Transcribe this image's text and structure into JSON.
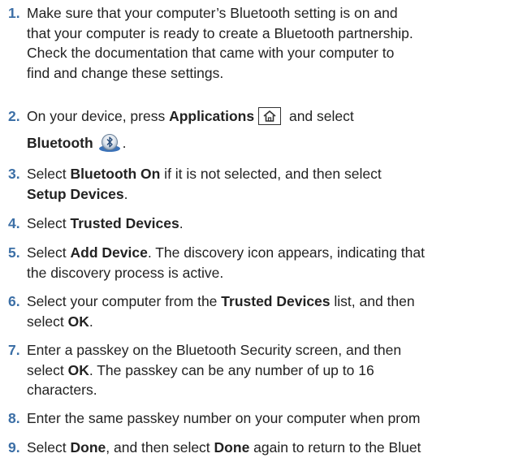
{
  "steps": [
    {
      "number": "1.",
      "lines": [
        "Make sure that your computer’s Bluetooth setting is on and",
        "that your computer is ready to create a Bluetooth partnership.",
        "Check the documentation that came with your computer to",
        "find and change these settings."
      ]
    },
    {
      "number": "2.",
      "pre": "On your device, press ",
      "bold1": "Applications",
      "post": " and select",
      "bold2": "Bluetooth",
      "key_icon": "home-icon",
      "app_icon": "bluetooth-app-icon"
    },
    {
      "number": "3.",
      "pre": "Select ",
      "bold1": "Bluetooth On",
      "post": " if it is not selected, and then select",
      "bold2": "Setup Devices",
      "end": "."
    },
    {
      "number": "4.",
      "pre": "Select ",
      "bold1": "Trusted Devices",
      "end": "."
    },
    {
      "number": "5.",
      "pre": "Select ",
      "bold1": "Add Device",
      "post": ". The discovery icon appears, indicating that",
      "line2": "the discovery process is active."
    },
    {
      "number": "6.",
      "pre": "Select your computer from the ",
      "bold1": "Trusted Devices",
      "post": " list, and then",
      "line2_pre": "select ",
      "bold2": "OK",
      "end": "."
    },
    {
      "number": "7.",
      "line1": "Enter a passkey on the Bluetooth Security screen, and then",
      "line2_pre": "select ",
      "bold1": "OK",
      "line2_post": ". The passkey can be any number of up to 16",
      "line3": "characters."
    },
    {
      "number": "8.",
      "text": "Enter the same passkey number on your computer when prom"
    },
    {
      "number": "9.",
      "pre": "Select ",
      "bold1": "Done",
      "mid": ", and then select ",
      "bold2": "Done",
      "post": " again to return to the Bluet"
    }
  ],
  "colors": {
    "step_number": "#3c6fa6",
    "text": "#222222"
  }
}
